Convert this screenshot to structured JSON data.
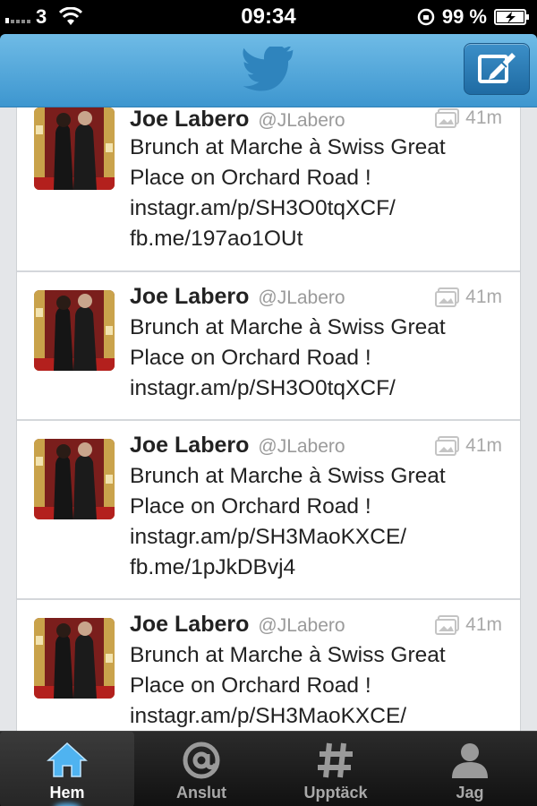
{
  "status_bar": {
    "carrier": "3",
    "time": "09:34",
    "battery": "99 %"
  },
  "colors": {
    "nav_bar": "#4aa3db",
    "tab_active_glow": "#5fc0ff",
    "tweet_text": "#222222",
    "meta_text": "#a9a9a9"
  },
  "icons": {
    "nav": "twitter-bird-icon",
    "compose": "compose-icon",
    "media": "media-icon"
  },
  "tweets": [
    {
      "name": "Joe Labero",
      "handle": "@JLabero",
      "time": "41m",
      "lines": [
        "Brunch at Marche à Swiss Great",
        "Place on Orchard Road !",
        "instagr.am/p/SH3O0tqXCF/",
        "fb.me/197ao1OUt"
      ]
    },
    {
      "name": "Joe Labero",
      "handle": "@JLabero",
      "time": "41m",
      "lines": [
        "Brunch at Marche à Swiss Great",
        "Place on Orchard Road !",
        "instagr.am/p/SH3O0tqXCF/"
      ]
    },
    {
      "name": "Joe Labero",
      "handle": "@JLabero",
      "time": "41m",
      "lines": [
        "Brunch at Marche à Swiss Great",
        "Place on Orchard Road !",
        "instagr.am/p/SH3MaoKXCE/",
        "fb.me/1pJkDBvj4"
      ]
    },
    {
      "name": "Joe Labero",
      "handle": "@JLabero",
      "time": "41m",
      "lines": [
        "Brunch at Marche à Swiss Great",
        "Place on Orchard Road !",
        "instagr.am/p/SH3MaoKXCE/"
      ]
    }
  ],
  "tabs": [
    {
      "label": "Hem",
      "icon": "home-icon",
      "active": true
    },
    {
      "label": "Anslut",
      "icon": "at-icon",
      "active": false
    },
    {
      "label": "Upptäck",
      "icon": "hash-icon",
      "active": false
    },
    {
      "label": "Jag",
      "icon": "person-icon",
      "active": false
    }
  ]
}
